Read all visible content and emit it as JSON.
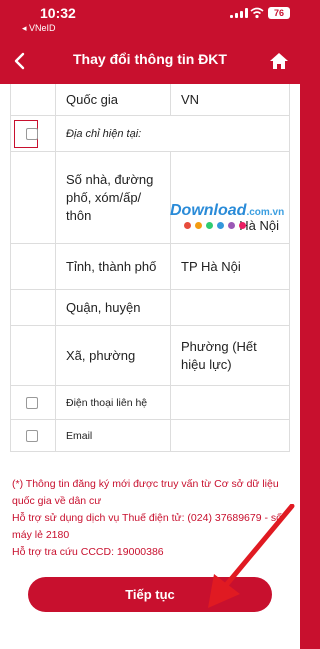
{
  "status_bar": {
    "time": "10:32",
    "back_app": "◂ VNeID",
    "battery": "76"
  },
  "header": {
    "title": "Thay đổi thông tin ĐKT",
    "back_icon": "chevron-left-icon",
    "home_icon": "home-icon"
  },
  "table": {
    "country_label": "Quốc gia",
    "country_value": "VN",
    "current_address_label": "Địa chỉ hiện tại:",
    "street_label": "Số nhà, đường phố, xóm/ấp/ thôn",
    "street_value": "Hà Nội",
    "province_label": "Tỉnh, thành phố",
    "province_value": "TP Hà Nội",
    "district_label": "Quận, huyện",
    "district_value": "",
    "ward_label": "Xã, phường",
    "ward_value": "Phường (Hết hiệu lực)",
    "phone_label": "Điện thoại liên hệ",
    "email_label": "Email"
  },
  "watermark": {
    "text": "Download",
    "suffix": ".com.vn"
  },
  "notes": {
    "line1": "(*) Thông tin đăng ký mới được truy vấn từ Cơ sở dữ liệu quốc gia về dân cư",
    "line2": "Hỗ trợ sử dụng dịch vụ Thuế điện tử: (024) 37689679 - số máy lẻ 2180",
    "line3": "Hỗ trợ tra cứu CCCD: 19000386"
  },
  "button": {
    "continue_label": "Tiếp tục"
  },
  "colors": {
    "brand_red": "#c8102e",
    "border": "#dddddd"
  }
}
